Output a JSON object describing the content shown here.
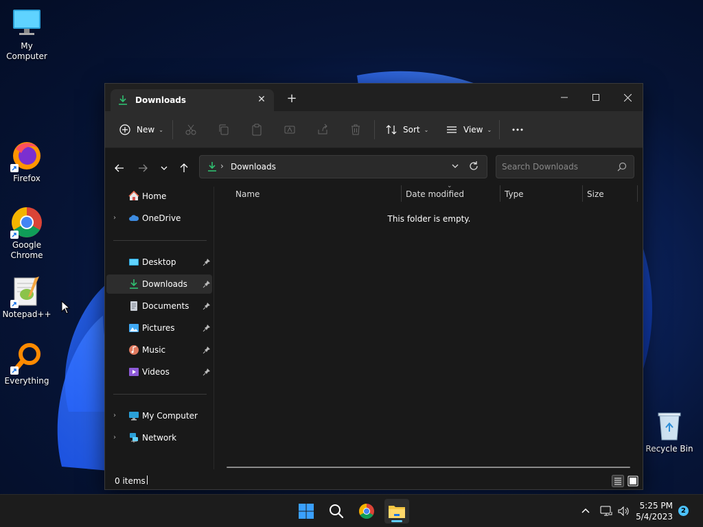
{
  "desktop": {
    "icons": [
      {
        "label": "My Computer"
      },
      {
        "label": "Firefox"
      },
      {
        "label": "Google Chrome"
      },
      {
        "label": "Notepad++"
      },
      {
        "label": "Everything"
      },
      {
        "label": "Recycle Bin"
      }
    ]
  },
  "window": {
    "tab_title": "Downloads",
    "toolbar": {
      "new_label": "New",
      "sort_label": "Sort",
      "view_label": "View"
    },
    "address": {
      "path": "Downloads",
      "search_placeholder": "Search Downloads"
    },
    "nav": {
      "items": [
        {
          "label": "Home"
        },
        {
          "label": "OneDrive"
        },
        {
          "label": "Desktop"
        },
        {
          "label": "Downloads"
        },
        {
          "label": "Documents"
        },
        {
          "label": "Pictures"
        },
        {
          "label": "Music"
        },
        {
          "label": "Videos"
        },
        {
          "label": "My Computer"
        },
        {
          "label": "Network"
        }
      ]
    },
    "columns": [
      "Name",
      "Date modified",
      "Type",
      "Size"
    ],
    "empty_message": "This folder is empty.",
    "status": {
      "item_count": "0 items"
    }
  },
  "taskbar": {
    "time": "5:25 PM",
    "date": "5/4/2023",
    "notification_count": "2"
  },
  "colors": {
    "accent": "#60cdff",
    "download_green": "#2fbf71",
    "folder_yellow": "#f4c542"
  }
}
